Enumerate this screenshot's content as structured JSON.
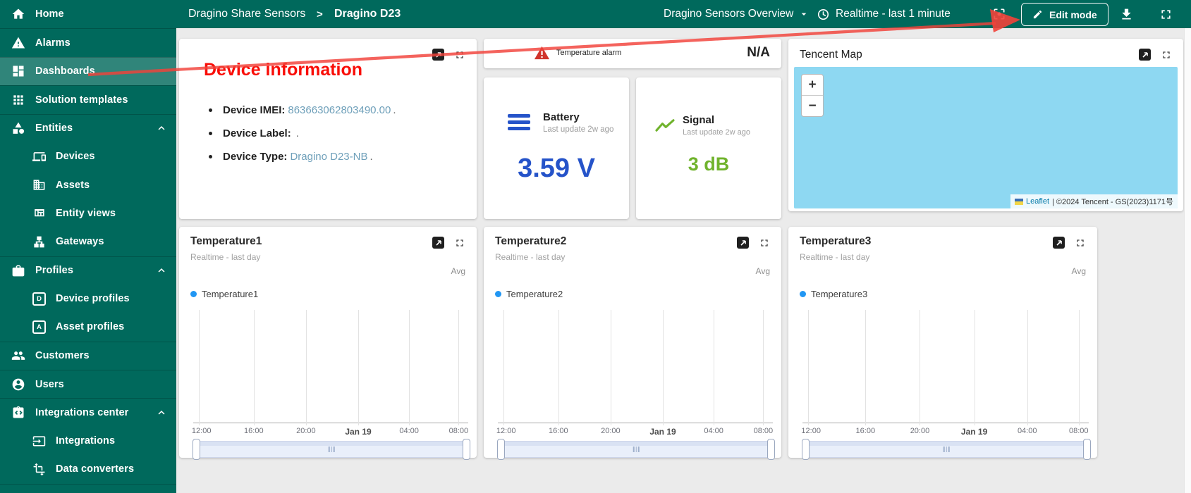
{
  "colors": {
    "primary_teal": "#00695c",
    "annotation_red": "#f44336",
    "battery_blue": "#2553c9",
    "signal_green": "#70b32d",
    "legend_blue": "#2196f3",
    "value_link_blue": "#6fa0ba",
    "map_water_blue": "#8ed8f2"
  },
  "sidebar": {
    "items": [
      {
        "label": "Home"
      },
      {
        "label": "Alarms"
      },
      {
        "label": "Dashboards"
      },
      {
        "label": "Solution templates"
      },
      {
        "label": "Entities"
      },
      {
        "label": "Devices"
      },
      {
        "label": "Assets"
      },
      {
        "label": "Entity views"
      },
      {
        "label": "Gateways"
      },
      {
        "label": "Profiles"
      },
      {
        "label": "Device profiles",
        "icon_letter": "D"
      },
      {
        "label": "Asset profiles",
        "icon_letter": "A"
      },
      {
        "label": "Customers"
      },
      {
        "label": "Users"
      },
      {
        "label": "Integrations center"
      },
      {
        "label": "Integrations"
      },
      {
        "label": "Data converters"
      }
    ]
  },
  "header": {
    "breadcrumb_root": "Dragino Share Sensors",
    "breadcrumb_separator": ">",
    "breadcrumb_current": "Dragino D23",
    "dashboard_selector": "Dragino Sensors Overview",
    "timewindow": "Realtime - last 1 minute",
    "edit_button": "Edit mode"
  },
  "annotation": {
    "text": "Device information"
  },
  "device_info": {
    "bullets": [
      {
        "label": "Device IMEI:",
        "value": "863663062803490.00",
        "suffix": "."
      },
      {
        "label": "Device Label:",
        "value": "",
        "suffix": "."
      },
      {
        "label": "Device Type:",
        "value": "Dragino D23-NB",
        "suffix": "."
      }
    ]
  },
  "alarm": {
    "label": "Temperature alarm",
    "value": "N/A"
  },
  "battery": {
    "title": "Battery",
    "subtitle": "Last update 2w ago",
    "value": "3.59 V"
  },
  "signal": {
    "title": "Signal",
    "subtitle": "Last update 2w ago",
    "value": "3 dB"
  },
  "map": {
    "title": "Tencent Map",
    "zoom_in": "+",
    "zoom_out": "−",
    "attribution_link": "Leaflet",
    "attribution_text": "| ©2024 Tencent - GS(2023)1171号"
  },
  "charts": [
    {
      "title": "Temperature1",
      "subtitle": "Realtime - last day",
      "aggregation": "Avg",
      "legend": "Temperature1"
    },
    {
      "title": "Temperature2",
      "subtitle": "Realtime - last day",
      "aggregation": "Avg",
      "legend": "Temperature2"
    },
    {
      "title": "Temperature3",
      "subtitle": "Realtime - last day",
      "aggregation": "Avg",
      "legend": "Temperature3"
    }
  ],
  "chart_data": {
    "type": "line",
    "x_ticks": [
      "12:00",
      "16:00",
      "20:00",
      "Jan 19",
      "04:00",
      "08:00"
    ],
    "series": [
      {
        "name": "Temperature1",
        "values": []
      },
      {
        "name": "Temperature2",
        "values": []
      },
      {
        "name": "Temperature3",
        "values": []
      }
    ],
    "ylim": null,
    "grid": "vertical-only",
    "legend_position": "top-left"
  }
}
